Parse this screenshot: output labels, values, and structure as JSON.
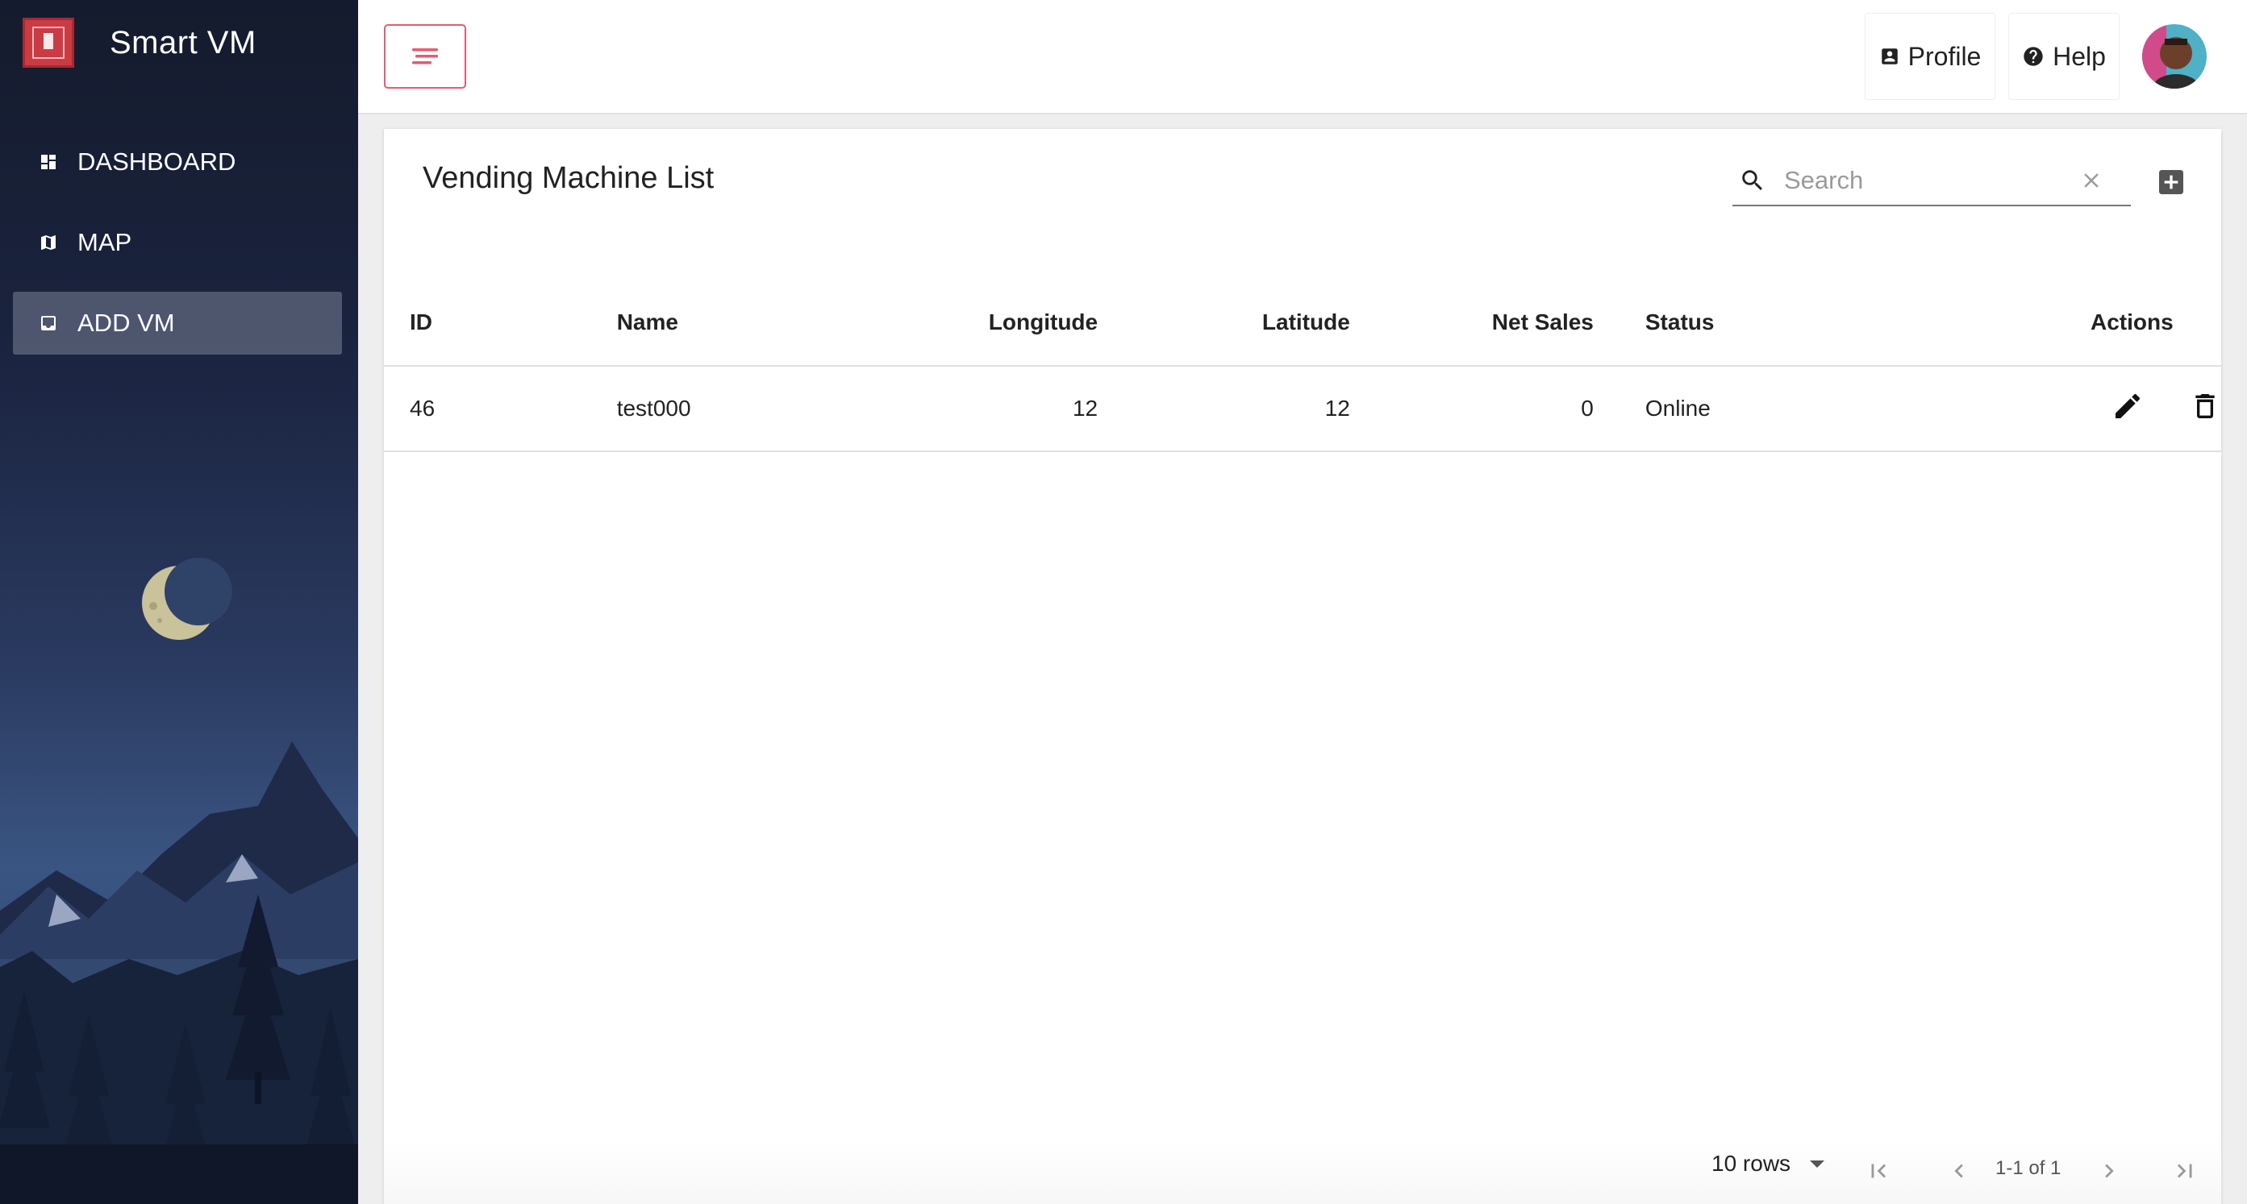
{
  "brand": {
    "title": "Smart VM"
  },
  "sidebar": {
    "items": [
      {
        "label": "DASHBOARD",
        "icon": "dashboard-icon",
        "active": false
      },
      {
        "label": "MAP",
        "icon": "map-icon",
        "active": false
      },
      {
        "label": "ADD VM",
        "icon": "inbox-icon",
        "active": true
      }
    ]
  },
  "topbar": {
    "menu_icon": "menu-icon",
    "profile_label": "Profile",
    "help_label": "Help"
  },
  "card": {
    "title": "Vending Machine List",
    "search_placeholder": "Search"
  },
  "table": {
    "columns": [
      "ID",
      "Name",
      "Longitude",
      "Latitude",
      "Net Sales",
      "Status",
      "Actions"
    ],
    "rows": [
      {
        "id": "46",
        "name": "test000",
        "longitude": "12",
        "latitude": "12",
        "net_sales": "0",
        "status": "Online"
      }
    ]
  },
  "pagination": {
    "rows_label": "10 rows",
    "info": "1-1 of 1"
  },
  "colors": {
    "accent": "#e65a72",
    "sidebar_top": "#141b2d",
    "brand_red": "#c93c44"
  }
}
